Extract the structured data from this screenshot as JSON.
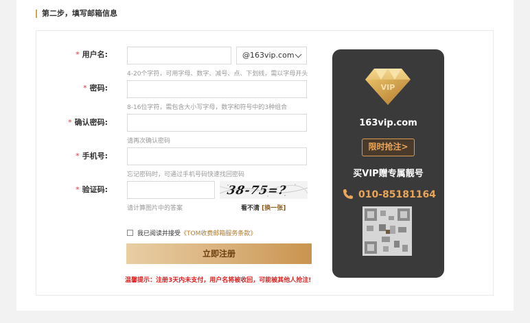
{
  "step": {
    "title": "第二步，填写邮箱信息"
  },
  "form": {
    "required_mark": "*",
    "username": {
      "label": "用户名:",
      "value": "",
      "domain": "@163vip.com",
      "hint": "4-20个字符，可用字母、数字、减号、点、下划线，需以字母开头"
    },
    "password": {
      "label": "密码:",
      "value": "",
      "hint": "8-16位字符，需包含大小写字母，数字和符号中的3种组合"
    },
    "confirm": {
      "label": "确认密码:",
      "value": "",
      "hint": "请再次确认密码"
    },
    "phone": {
      "label": "手机号:",
      "value": "",
      "hint": "忘记密码时，可通过手机号码快速找回密码"
    },
    "captcha": {
      "label": "验证码:",
      "value": "",
      "hint": "请计算图片中的答案",
      "image_text": "38-75=?",
      "cant_see": "看不清",
      "refresh": "[换一张]"
    },
    "agree": {
      "prefix": "我已阅读并接受",
      "terms": "《TOM收费邮箱服务条款》",
      "checked": false
    },
    "submit_label": "立即注册",
    "warning": "温馨提示：注册3天内未支付，用户名将被收回，可能被其他人抢注!"
  },
  "vip": {
    "badge": "VIP",
    "domain": "163vip.com",
    "button": "限时抢注>",
    "slogan": "买VIP赠专属靓号",
    "phone": "010-85181164",
    "colors": {
      "card": "#3a3a3a",
      "accent": "#e9a65a",
      "gold": "#d4a64a"
    }
  }
}
